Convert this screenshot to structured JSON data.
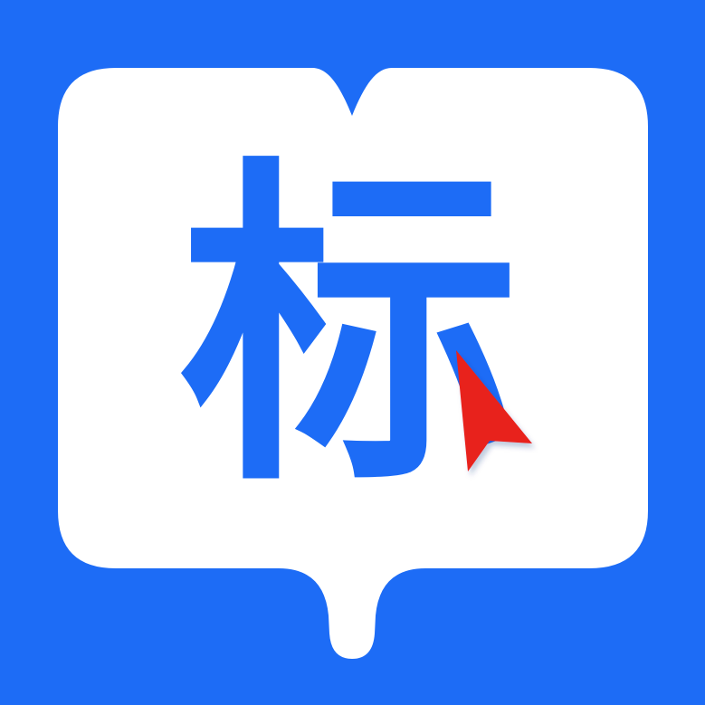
{
  "icon": {
    "glyph": "标",
    "icon_names": [
      "open-book-speech-bubble-icon",
      "cursor-arrow-icon"
    ]
  },
  "colors": {
    "background": "#1D6CF6",
    "bubble": "#FFFFFF",
    "glyph": "#1D6CF6",
    "cursor": "#E8201F"
  }
}
